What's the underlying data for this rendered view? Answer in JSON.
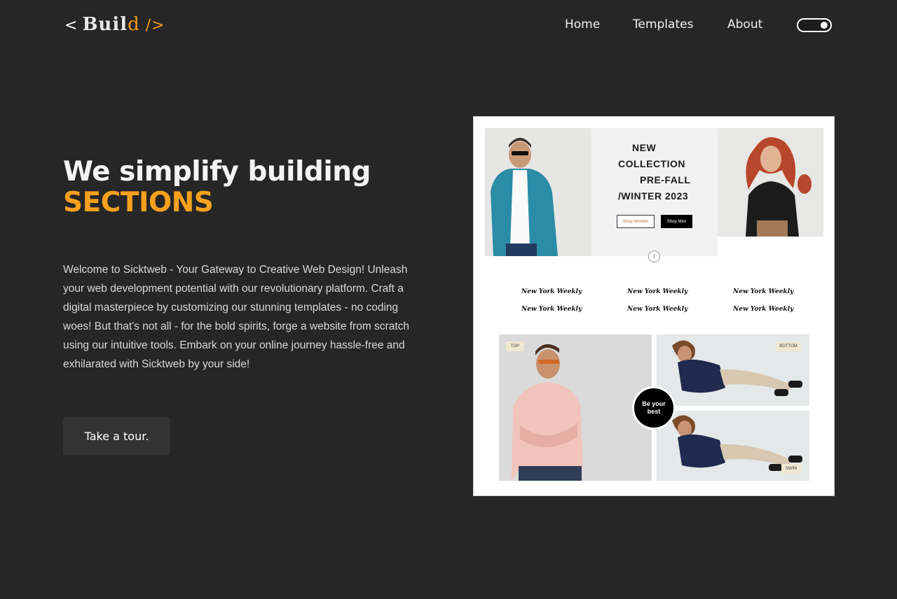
{
  "header": {
    "logo": {
      "open": "<",
      "main": "Buil",
      "accent": "d",
      "close": "/>"
    },
    "nav": [
      {
        "label": "Home"
      },
      {
        "label": "Templates"
      },
      {
        "label": "About"
      }
    ],
    "theme_toggle": {
      "state": "on"
    }
  },
  "hero": {
    "title": "We simplify building",
    "title_accent": "SECTIONS",
    "description": "Welcome to Sicktweb - Your Gateway to Creative Web Design! Unleash your web development potential with our revolutionary platform. Craft a digital masterpiece by customizing our stunning templates - no coding woes! But that's not all - for the bold spirits, forge a website from scratch using our intuitive tools. Embark on your online journey hassle-free and exhilarated with Sicktweb by your side!",
    "cta_label": "Take a tour."
  },
  "preview": {
    "banner_lines": [
      "NEW",
      "COLLECTION",
      "PRE-FALL",
      "/WINTER 2023"
    ],
    "shop_women": "Shop Women",
    "shop_men": "Shop Men",
    "press_logos": [
      "New York Weekly",
      "New York Weekly",
      "New York Weekly",
      "New York Weekly",
      "New York Weekly",
      "New York Weekly"
    ],
    "tags": {
      "top": "TOP",
      "bottom": "BOTTOM",
      "swim": "SWIM"
    },
    "badge": "Be your best"
  },
  "colors": {
    "background": "#262626",
    "accent": "#f6a11d",
    "button": "#333333"
  }
}
